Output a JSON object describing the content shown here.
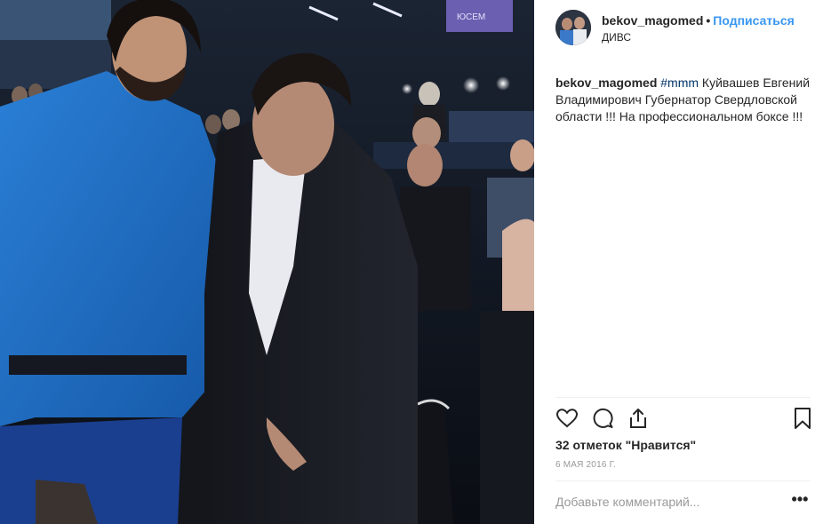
{
  "post": {
    "username": "bekov_magomed",
    "separator": "•",
    "follow_label": "Подписаться",
    "location": "ДИВС",
    "caption": {
      "username": "bekov_magomed",
      "hashtag": "#mmm",
      "text": " Куйвашев Евгений Владимирович Губернатор Свердловской области !!! На профессиональном боксе !!!"
    },
    "likes_text": "32 отметок \"Нравится\"",
    "date": "6 МАЯ 2016 Г.",
    "comment_placeholder": "Добавьте комментарий...",
    "more_label": "•••"
  },
  "photo": {
    "screen_text": "ЮСЕМ"
  },
  "icons": {
    "like": "heart-icon",
    "comment": "comment-icon",
    "share": "share-icon",
    "save": "bookmark-icon",
    "more": "more-icon"
  },
  "colors": {
    "link": "#3897f0",
    "hashtag": "#003569",
    "muted": "#999999",
    "text": "#262626"
  }
}
